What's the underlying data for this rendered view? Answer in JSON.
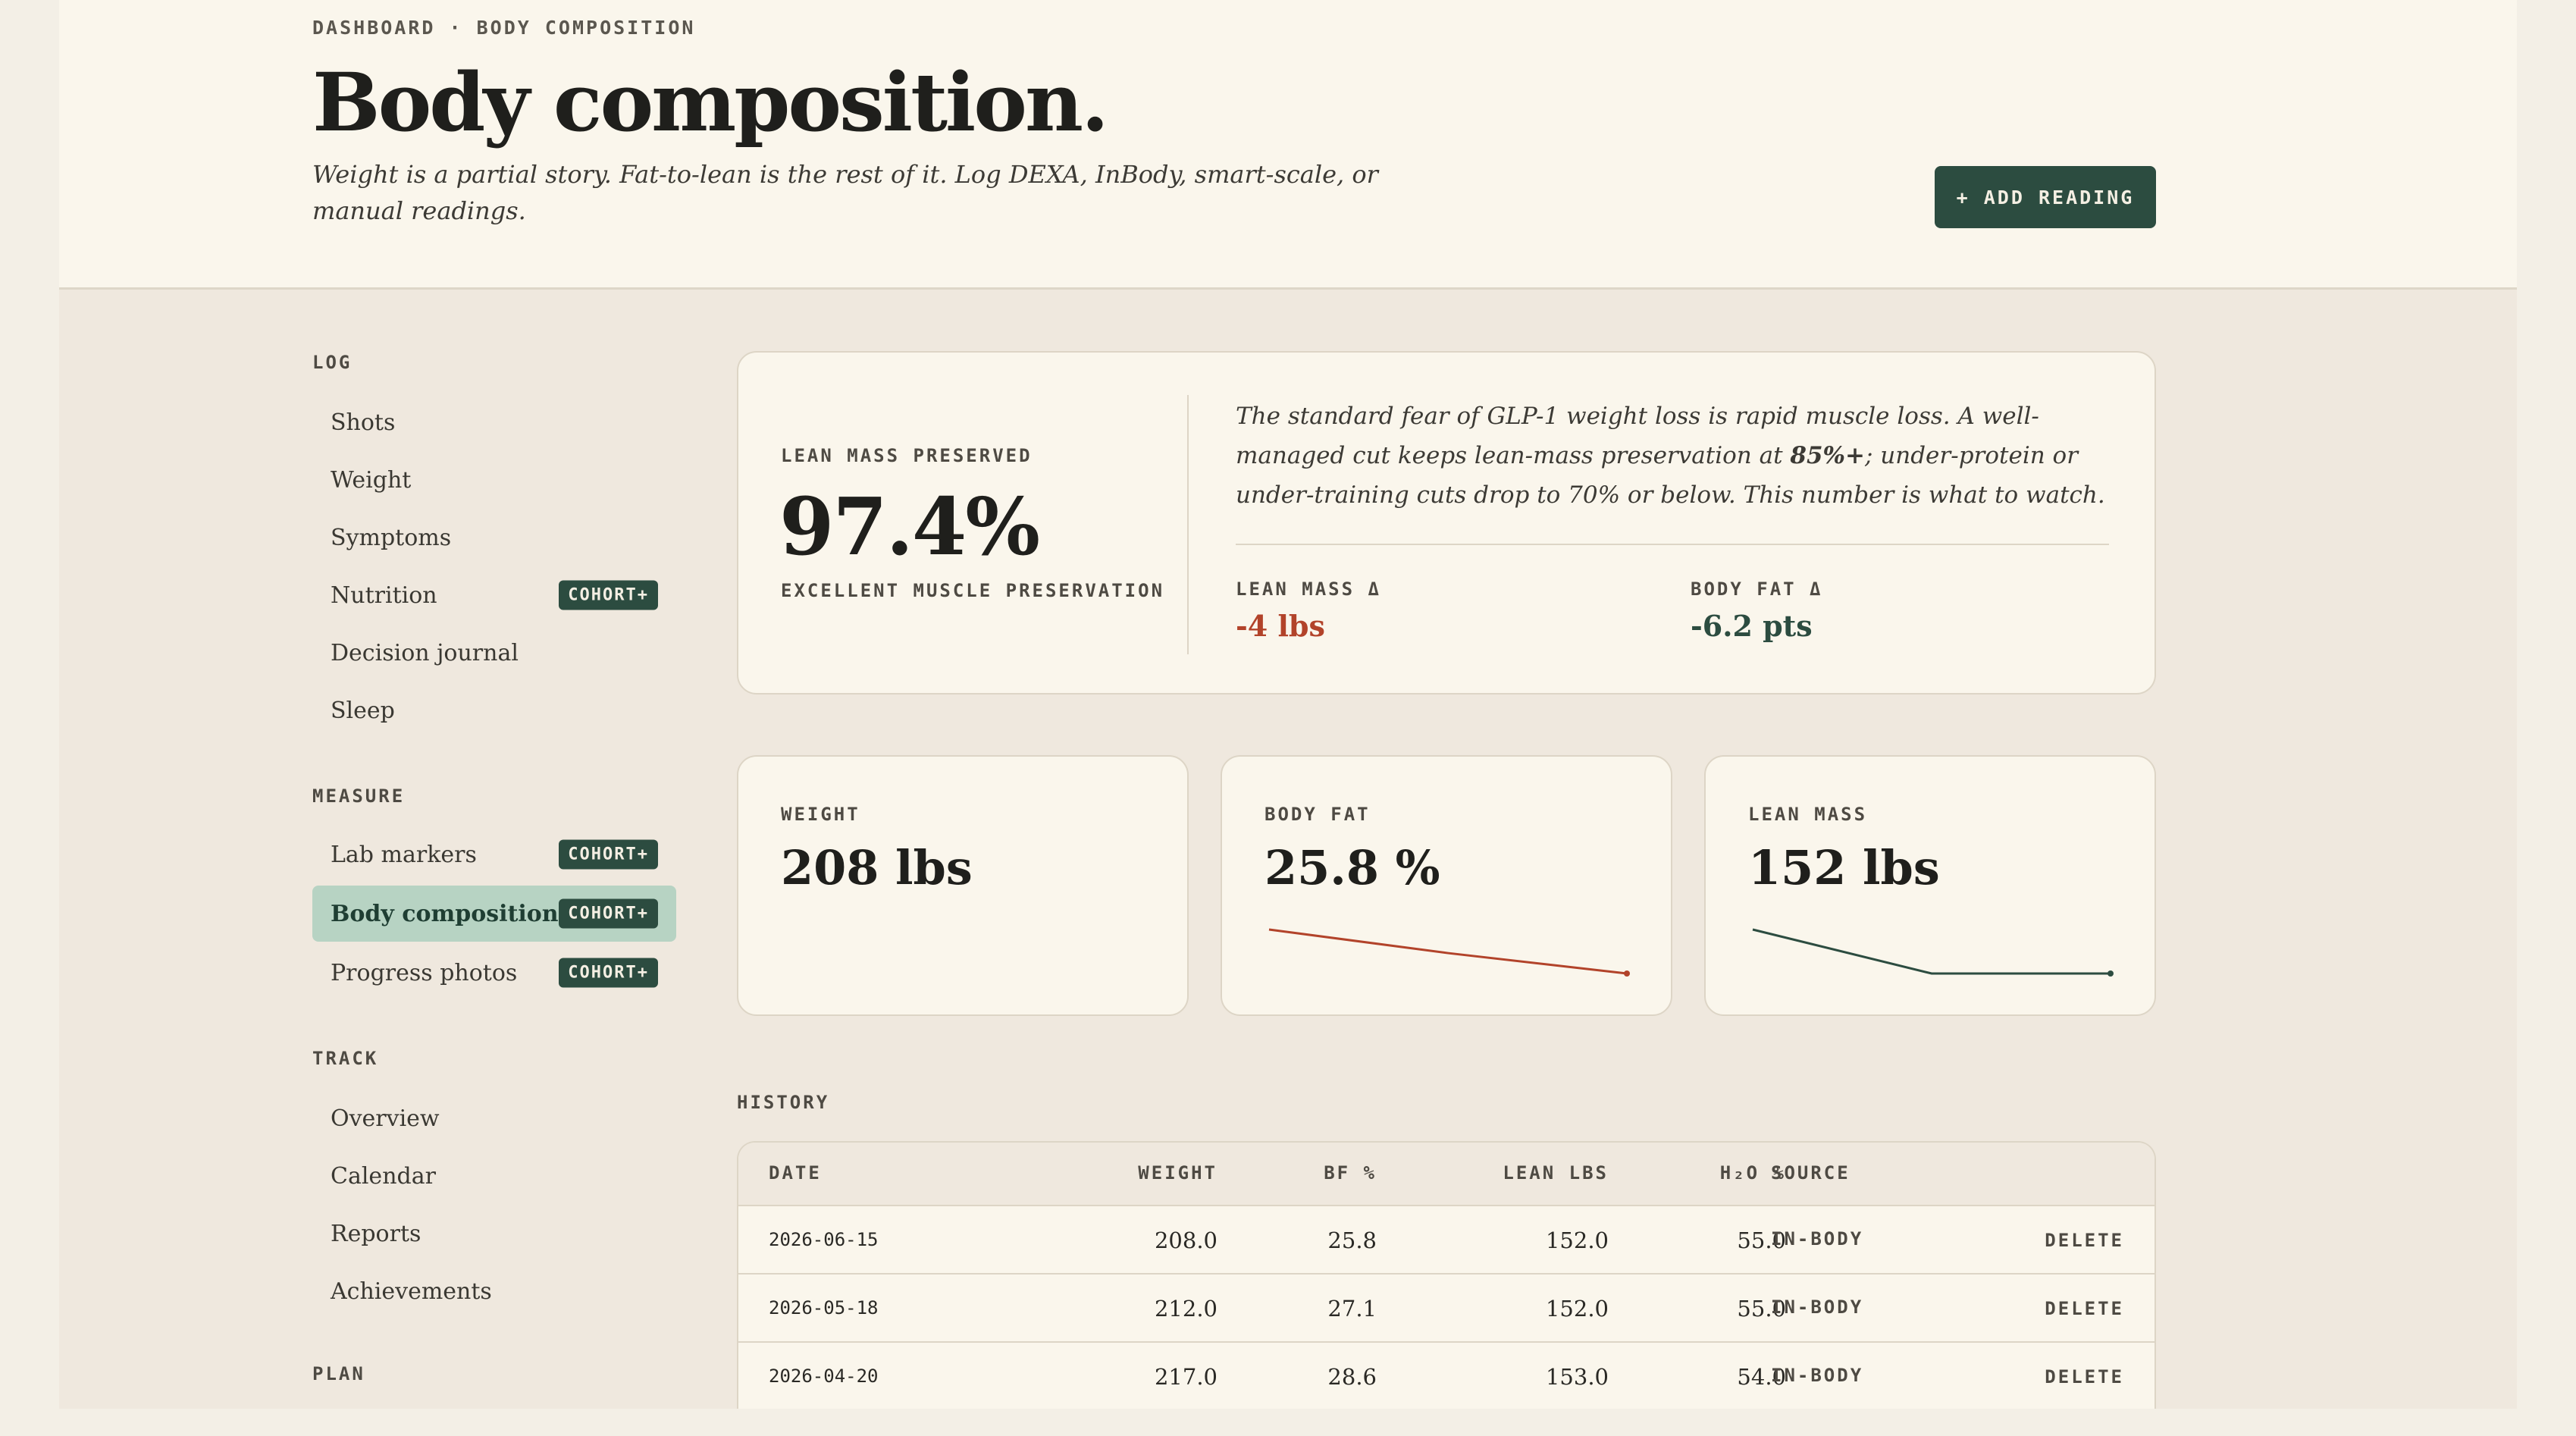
{
  "header": {
    "breadcrumb": "DASHBOARD · BODY COMPOSITION",
    "title": "Body composition.",
    "subtitle": "Weight is a partial story. Fat-to-lean is the rest of it. Log DEXA, InBody, smart-scale, or manual readings.",
    "add_button": "+ ADD READING"
  },
  "sidebar": {
    "sections": [
      {
        "title": "LOG",
        "items": [
          {
            "label": "Shots"
          },
          {
            "label": "Weight"
          },
          {
            "label": "Symptoms"
          },
          {
            "label": "Nutrition",
            "badge": "COHORT+"
          },
          {
            "label": "Decision journal"
          },
          {
            "label": "Sleep"
          }
        ]
      },
      {
        "title": "MEASURE",
        "items": [
          {
            "label": "Lab markers",
            "badge": "COHORT+"
          },
          {
            "label": "Body composition",
            "badge": "COHORT+",
            "active": true
          },
          {
            "label": "Progress photos",
            "badge": "COHORT+"
          }
        ]
      },
      {
        "title": "TRACK",
        "items": [
          {
            "label": "Overview"
          },
          {
            "label": "Calendar"
          },
          {
            "label": "Reports"
          },
          {
            "label": "Achievements"
          }
        ]
      },
      {
        "title": "PLAN",
        "items": []
      }
    ]
  },
  "lean_card": {
    "label": "LEAN MASS PRESERVED",
    "value": "97.4%",
    "verdict": "EXCELLENT MUSCLE PRESERVATION",
    "note_before": "The standard fear of GLP-1 weight loss is rapid muscle loss. A well-managed cut keeps lean-mass preservation at ",
    "note_bold": "85%+",
    "note_after": "; under-protein or under-training cuts drop to 70% or below. This number is what to watch.",
    "lean_delta_label": "LEAN MASS Δ",
    "lean_delta_value": "-4 lbs",
    "fat_delta_label": "BODY FAT Δ",
    "fat_delta_value": "-6.2 pts"
  },
  "stats": [
    {
      "label": "WEIGHT",
      "value": "208 lbs"
    },
    {
      "label": "BODY FAT",
      "value": "25.8 %",
      "spark": [
        28.6,
        27.1,
        25.8
      ],
      "color": "#b2432a"
    },
    {
      "label": "LEAN MASS",
      "value": "152 lbs",
      "spark": [
        153.0,
        152.0,
        152.0
      ],
      "color": "#2c4c40"
    }
  ],
  "history": {
    "title": "HISTORY",
    "columns": [
      "DATE",
      "WEIGHT",
      "BF %",
      "LEAN LBS",
      "H₂O %",
      "SOURCE"
    ],
    "rows": [
      {
        "date": "2026-06-15",
        "weight": "208.0",
        "bf": "25.8",
        "lean": "152.0",
        "h2o": "55.0",
        "source": "IN-BODY",
        "action": "DELETE"
      },
      {
        "date": "2026-05-18",
        "weight": "212.0",
        "bf": "27.1",
        "lean": "152.0",
        "h2o": "55.0",
        "source": "IN-BODY",
        "action": "DELETE"
      },
      {
        "date": "2026-04-20",
        "weight": "217.0",
        "bf": "28.6",
        "lean": "153.0",
        "h2o": "54.0",
        "source": "IN-BODY",
        "action": "DELETE"
      }
    ]
  },
  "colors": {
    "accent": "#2c4c40",
    "negative": "#b2432a",
    "active_bg": "#b7d3c3"
  }
}
